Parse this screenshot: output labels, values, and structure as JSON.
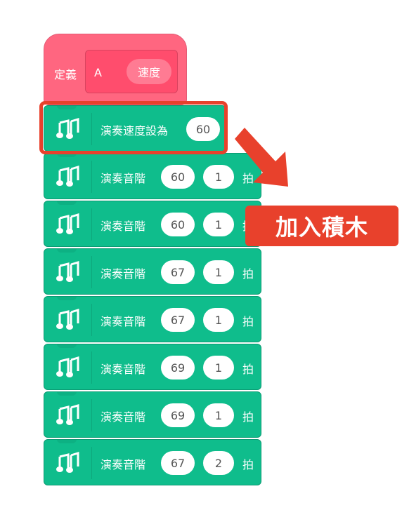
{
  "define_block": {
    "label": "定義",
    "name": "A",
    "param": "速度"
  },
  "tempo_block": {
    "label": "演奏速度設為",
    "value": "60"
  },
  "note_blocks": [
    {
      "label": "演奏音階",
      "note": "60",
      "beats": "1",
      "suffix": "拍"
    },
    {
      "label": "演奏音階",
      "note": "60",
      "beats": "1",
      "suffix": "拍"
    },
    {
      "label": "演奏音階",
      "note": "67",
      "beats": "1",
      "suffix": "拍"
    },
    {
      "label": "演奏音階",
      "note": "67",
      "beats": "1",
      "suffix": "拍"
    },
    {
      "label": "演奏音階",
      "note": "69",
      "beats": "1",
      "suffix": "拍"
    },
    {
      "label": "演奏音階",
      "note": "69",
      "beats": "1",
      "suffix": "拍"
    },
    {
      "label": "演奏音階",
      "note": "67",
      "beats": "2",
      "suffix": "拍"
    }
  ],
  "callout": {
    "text": "加入積木"
  },
  "icons": {
    "music": "music-note-icon",
    "arrow": "arrow-down-right-icon"
  },
  "colors": {
    "define": "#ff6680",
    "music": "#0fbd8c",
    "highlight": "#e8412c",
    "callout": "#e8412c"
  }
}
